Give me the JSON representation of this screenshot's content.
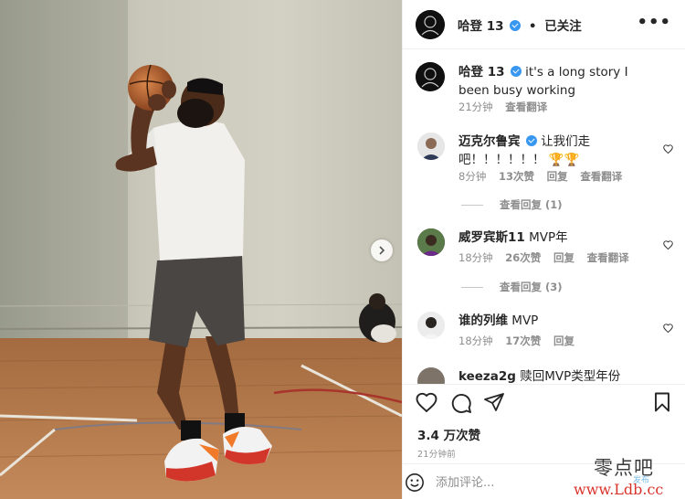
{
  "post": {
    "author": "哈登 13",
    "follow_status": "已关注",
    "caption": "it's a long story I been busy working",
    "caption_time": "21分钟",
    "translate": "查看翻译"
  },
  "comments": [
    {
      "user": "迈克尔鲁宾",
      "verified": true,
      "text": "让我们走吧！！！！！！",
      "emoji": "🏆🏆",
      "time": "8分钟",
      "likes": "13次赞",
      "reply": "回复",
      "translate": "查看翻译",
      "view_replies": "查看回复 (1)"
    },
    {
      "user": "威罗宾斯11",
      "verified": false,
      "text": "MVP年",
      "time": "18分钟",
      "likes": "26次赞",
      "reply": "回复",
      "translate": "查看翻译",
      "view_replies": "查看回复 (3)"
    },
    {
      "user": "谁的列维",
      "verified": false,
      "text": "MVP",
      "time": "18分钟",
      "likes": "17次赞",
      "reply": "回复"
    },
    {
      "user": "keeza2g",
      "verified": false,
      "text": "赎回MVP类型年份"
    }
  ],
  "engagement": {
    "likes_count": "3.4 万次赞",
    "posted_ago": "21分钟前"
  },
  "comment_box": {
    "placeholder": "添加评论..."
  },
  "watermark": {
    "line1": "零点吧",
    "line2": "发布",
    "line3": "www.Ldb.cc"
  },
  "icons": {
    "more": "more-horizontal-icon",
    "verified": "verified-badge-icon",
    "like": "heart-icon",
    "comment": "comment-bubble-icon",
    "share": "paper-plane-icon",
    "save": "bookmark-icon",
    "emoji": "smiley-icon",
    "next": "chevron-right-icon"
  },
  "colors": {
    "verified_blue": "#3897f0",
    "muted_text": "#8e8e8e",
    "primary_text": "#262626"
  }
}
